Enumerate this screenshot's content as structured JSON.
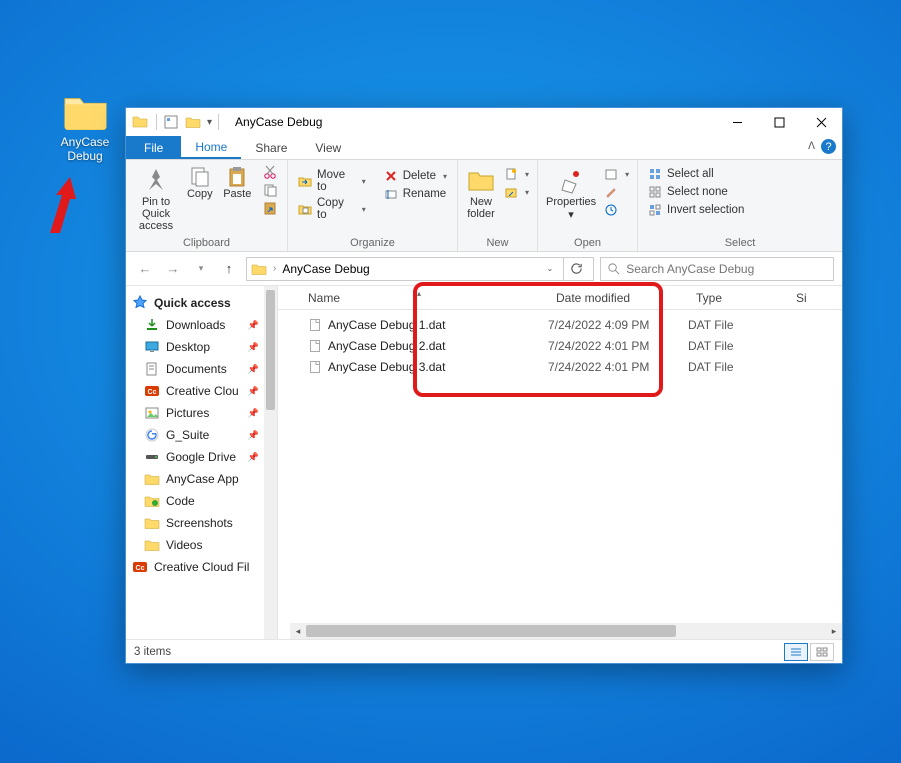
{
  "desktop": {
    "folder_label": "AnyCase\nDebug"
  },
  "window": {
    "title": "AnyCase Debug",
    "tabs": {
      "file": "File",
      "home": "Home",
      "share": "Share",
      "view": "View"
    },
    "ribbon": {
      "clipboard": {
        "pin": "Pin to Quick\naccess",
        "copy": "Copy",
        "paste": "Paste",
        "cut": "Cut",
        "copypath": "Copy path",
        "pasteshort": "Paste shortcut",
        "group": "Clipboard"
      },
      "organize": {
        "moveto": "Move to",
        "copyto": "Copy to",
        "delete": "Delete",
        "rename": "Rename",
        "group": "Organize"
      },
      "new": {
        "newfolder": "New\nfolder",
        "newitem": "New item",
        "easyaccess": "Easy access",
        "group": "New"
      },
      "open": {
        "properties": "Properties",
        "open": "Open",
        "edit": "Edit",
        "history": "History",
        "group": "Open"
      },
      "select": {
        "selectall": "Select all",
        "selectnone": "Select none",
        "invert": "Invert selection",
        "group": "Select"
      }
    },
    "address": {
      "crumb": "AnyCase Debug"
    },
    "search": {
      "placeholder": "Search AnyCase Debug"
    },
    "sidebar": {
      "quickaccess": "Quick access",
      "items": [
        {
          "label": "Downloads",
          "icon": "download",
          "pinned": true
        },
        {
          "label": "Desktop",
          "icon": "desktop",
          "pinned": true
        },
        {
          "label": "Documents",
          "icon": "documents",
          "pinned": true
        },
        {
          "label": "Creative Clou",
          "icon": "cc",
          "pinned": true
        },
        {
          "label": "Pictures",
          "icon": "pictures",
          "pinned": true
        },
        {
          "label": "G_Suite",
          "icon": "gsuite",
          "pinned": true
        },
        {
          "label": "Google Drive",
          "icon": "gdrive",
          "pinned": true
        },
        {
          "label": "AnyCase App",
          "icon": "folder",
          "pinned": false
        },
        {
          "label": "Code",
          "icon": "code",
          "pinned": false
        },
        {
          "label": "Screenshots",
          "icon": "folder",
          "pinned": false
        },
        {
          "label": "Videos",
          "icon": "folder",
          "pinned": false
        }
      ],
      "ccfiles": "Creative Cloud Fil"
    },
    "columns": {
      "name": "Name",
      "date": "Date modified",
      "type": "Type",
      "size": "Si"
    },
    "files": [
      {
        "name": "AnyCase Debug 1.dat",
        "date": "7/24/2022 4:09 PM",
        "type": "DAT File"
      },
      {
        "name": "AnyCase Debug 2.dat",
        "date": "7/24/2022 4:01 PM",
        "type": "DAT File"
      },
      {
        "name": "AnyCase Debug 3.dat",
        "date": "7/24/2022 4:01 PM",
        "type": "DAT File"
      }
    ],
    "status": {
      "count": "3 items"
    }
  }
}
